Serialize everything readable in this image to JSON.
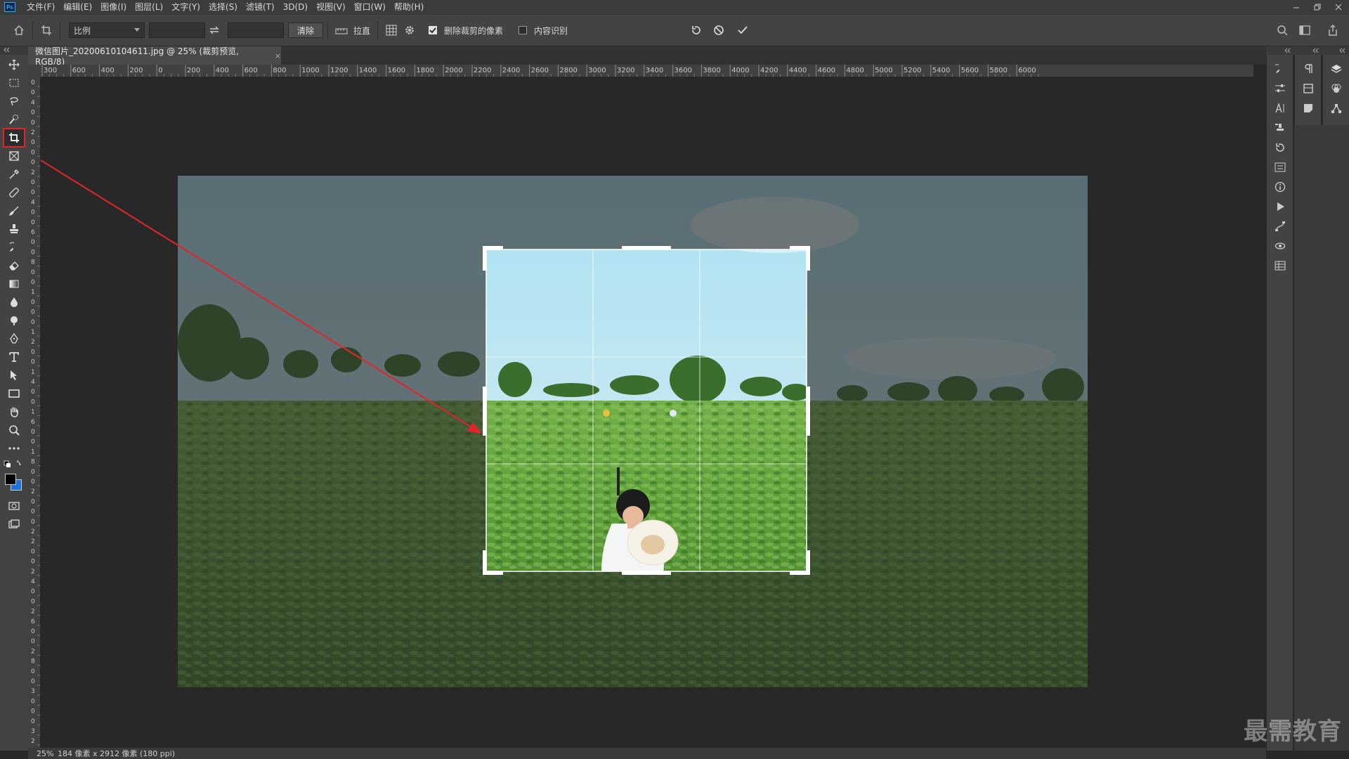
{
  "app": {
    "logo": "Ps"
  },
  "menu": [
    "文件(F)",
    "编辑(E)",
    "图像(I)",
    "图层(L)",
    "文字(Y)",
    "选择(S)",
    "滤镜(T)",
    "3D(D)",
    "视图(V)",
    "窗口(W)",
    "帮助(H)"
  ],
  "options": {
    "ratio_value": "比例",
    "width_value": "",
    "height_value": "",
    "clear_label": "清除",
    "straighten_label": "拉直",
    "delete_cropped_label": "删除裁剪的像素",
    "delete_cropped_checked": true,
    "content_aware_label": "内容识别",
    "content_aware_checked": false
  },
  "document": {
    "tab_title": "微信图片_20200610104611.jpg @ 25% (裁剪预览, RGB/8)",
    "tab_close": "×"
  },
  "ruler": {
    "h_labels": [
      "300",
      "600",
      "400",
      "200",
      "0",
      "200",
      "400",
      "600",
      "800",
      "1000",
      "1200",
      "1400",
      "1600",
      "1800",
      "2000",
      "2200",
      "2400",
      "2600",
      "2800",
      "3000",
      "3200",
      "3400",
      "3600",
      "3800",
      "4000",
      "4200",
      "4400",
      "4600",
      "4800",
      "5000",
      "5200",
      "5400",
      "5600",
      "5800",
      "6000"
    ],
    "v_labels": [
      "0",
      "0",
      "4",
      "0",
      "0",
      "2",
      "0",
      "0",
      "0",
      "2",
      "0",
      "0",
      "4",
      "0",
      "0",
      "6",
      "0",
      "0",
      "8",
      "0",
      "0",
      "1",
      "0",
      "0",
      "0",
      "1",
      "2",
      "0",
      "0",
      "1",
      "4",
      "0",
      "0",
      "1",
      "6",
      "0",
      "0",
      "1",
      "8",
      "0",
      "0",
      "2",
      "0",
      "0",
      "0",
      "2",
      "2",
      "0",
      "0",
      "2",
      "4",
      "0",
      "0",
      "2",
      "6",
      "0",
      "0",
      "2",
      "8",
      "0",
      "0",
      "3",
      "0",
      "0",
      "0",
      "3",
      "2"
    ]
  },
  "status": {
    "zoom": "25%",
    "doc_info": "184 像素 x 2912 像素 (180 ppi)"
  },
  "watermark": "最需教育",
  "colors": {
    "annotation_red": "#e0252b",
    "foreground": "#000000",
    "background": "#1e73d9"
  },
  "tools": [
    "move-tool-icon",
    "marquee-tool-icon",
    "lasso-tool-icon",
    "quick-select-tool-icon",
    "crop-tool-icon",
    "frame-tool-icon",
    "eyedropper-tool-icon",
    "healing-tool-icon",
    "brush-tool-icon",
    "stamp-tool-icon",
    "history-brush-tool-icon",
    "eraser-tool-icon",
    "gradient-tool-icon",
    "blur-tool-icon",
    "dodge-tool-icon",
    "pen-tool-icon",
    "type-tool-icon",
    "path-select-tool-icon",
    "rectangle-tool-icon",
    "hand-tool-icon",
    "zoom-tool-icon",
    "more-tools-icon"
  ]
}
